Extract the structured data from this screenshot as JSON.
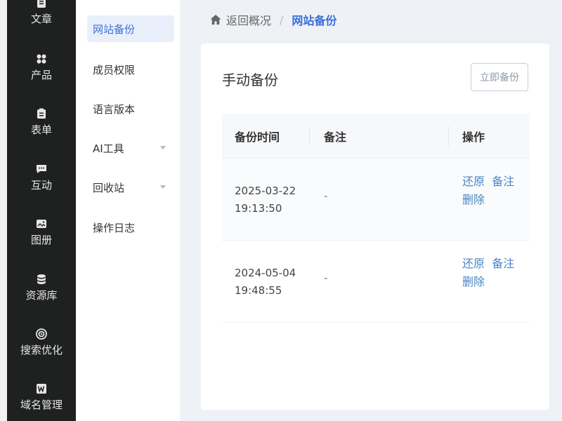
{
  "rail": {
    "items": [
      {
        "label": "文章",
        "icon": "document-icon"
      },
      {
        "label": "产品",
        "icon": "grid-icon"
      },
      {
        "label": "表单",
        "icon": "form-icon"
      },
      {
        "label": "互动",
        "icon": "chat-icon"
      },
      {
        "label": "图册",
        "icon": "album-icon"
      },
      {
        "label": "资源库",
        "icon": "database-icon"
      },
      {
        "label": "搜索优化",
        "icon": "target-icon"
      },
      {
        "label": "域名管理",
        "icon": "w-icon"
      }
    ]
  },
  "submenu": {
    "items": [
      {
        "label": "网站备份",
        "active": true
      },
      {
        "label": "成员权限"
      },
      {
        "label": "语言版本"
      },
      {
        "label": "AI工具",
        "has_caret": true
      },
      {
        "label": "回收站",
        "has_caret": true
      },
      {
        "label": "操作日志"
      }
    ]
  },
  "breadcrumb": {
    "back_label": "返回概况",
    "separator": "/",
    "current": "网站备份"
  },
  "card": {
    "title": "手动备份",
    "backup_button": "立即备份"
  },
  "table": {
    "headers": {
      "time": "备份时间",
      "note": "备注",
      "ops": "操作"
    },
    "rows": [
      {
        "time": "2025-03-22 19:13:50",
        "note": "-",
        "restore": "还原",
        "remark": "备注",
        "delete": "删除"
      },
      {
        "time": "2024-05-04 19:48:55",
        "note": "-",
        "restore": "还原",
        "remark": "备注",
        "delete": "删除"
      }
    ]
  },
  "colors": {
    "rail_bg": "#1f2020",
    "accent": "#3a6fd8",
    "link": "#4c86c6",
    "main_bg": "#eef1f6"
  }
}
